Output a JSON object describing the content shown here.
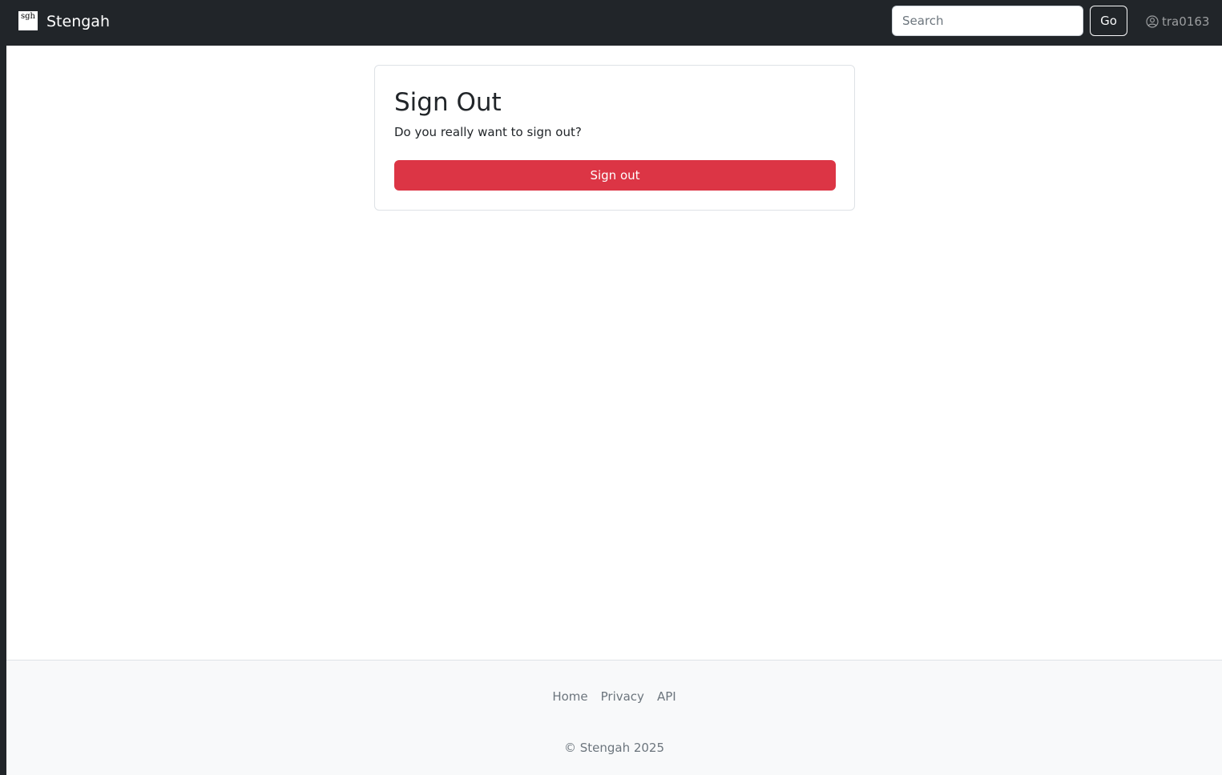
{
  "navbar": {
    "logo_text": "sgh",
    "brand": "Stengah",
    "search_placeholder": "Search",
    "search_value": "",
    "go_label": "Go",
    "username": "tra0163",
    "user_icon": "person-circle-icon"
  },
  "card": {
    "title": "Sign Out",
    "text": "Do you really want to sign out?",
    "button_label": "Sign out"
  },
  "footer": {
    "links": [
      "Home",
      "Privacy",
      "API"
    ],
    "copyright": "© Stengah 2025"
  },
  "colors": {
    "navbar_bg": "#212529",
    "danger": "#dc3545",
    "footer_bg": "#f8f9fa"
  }
}
